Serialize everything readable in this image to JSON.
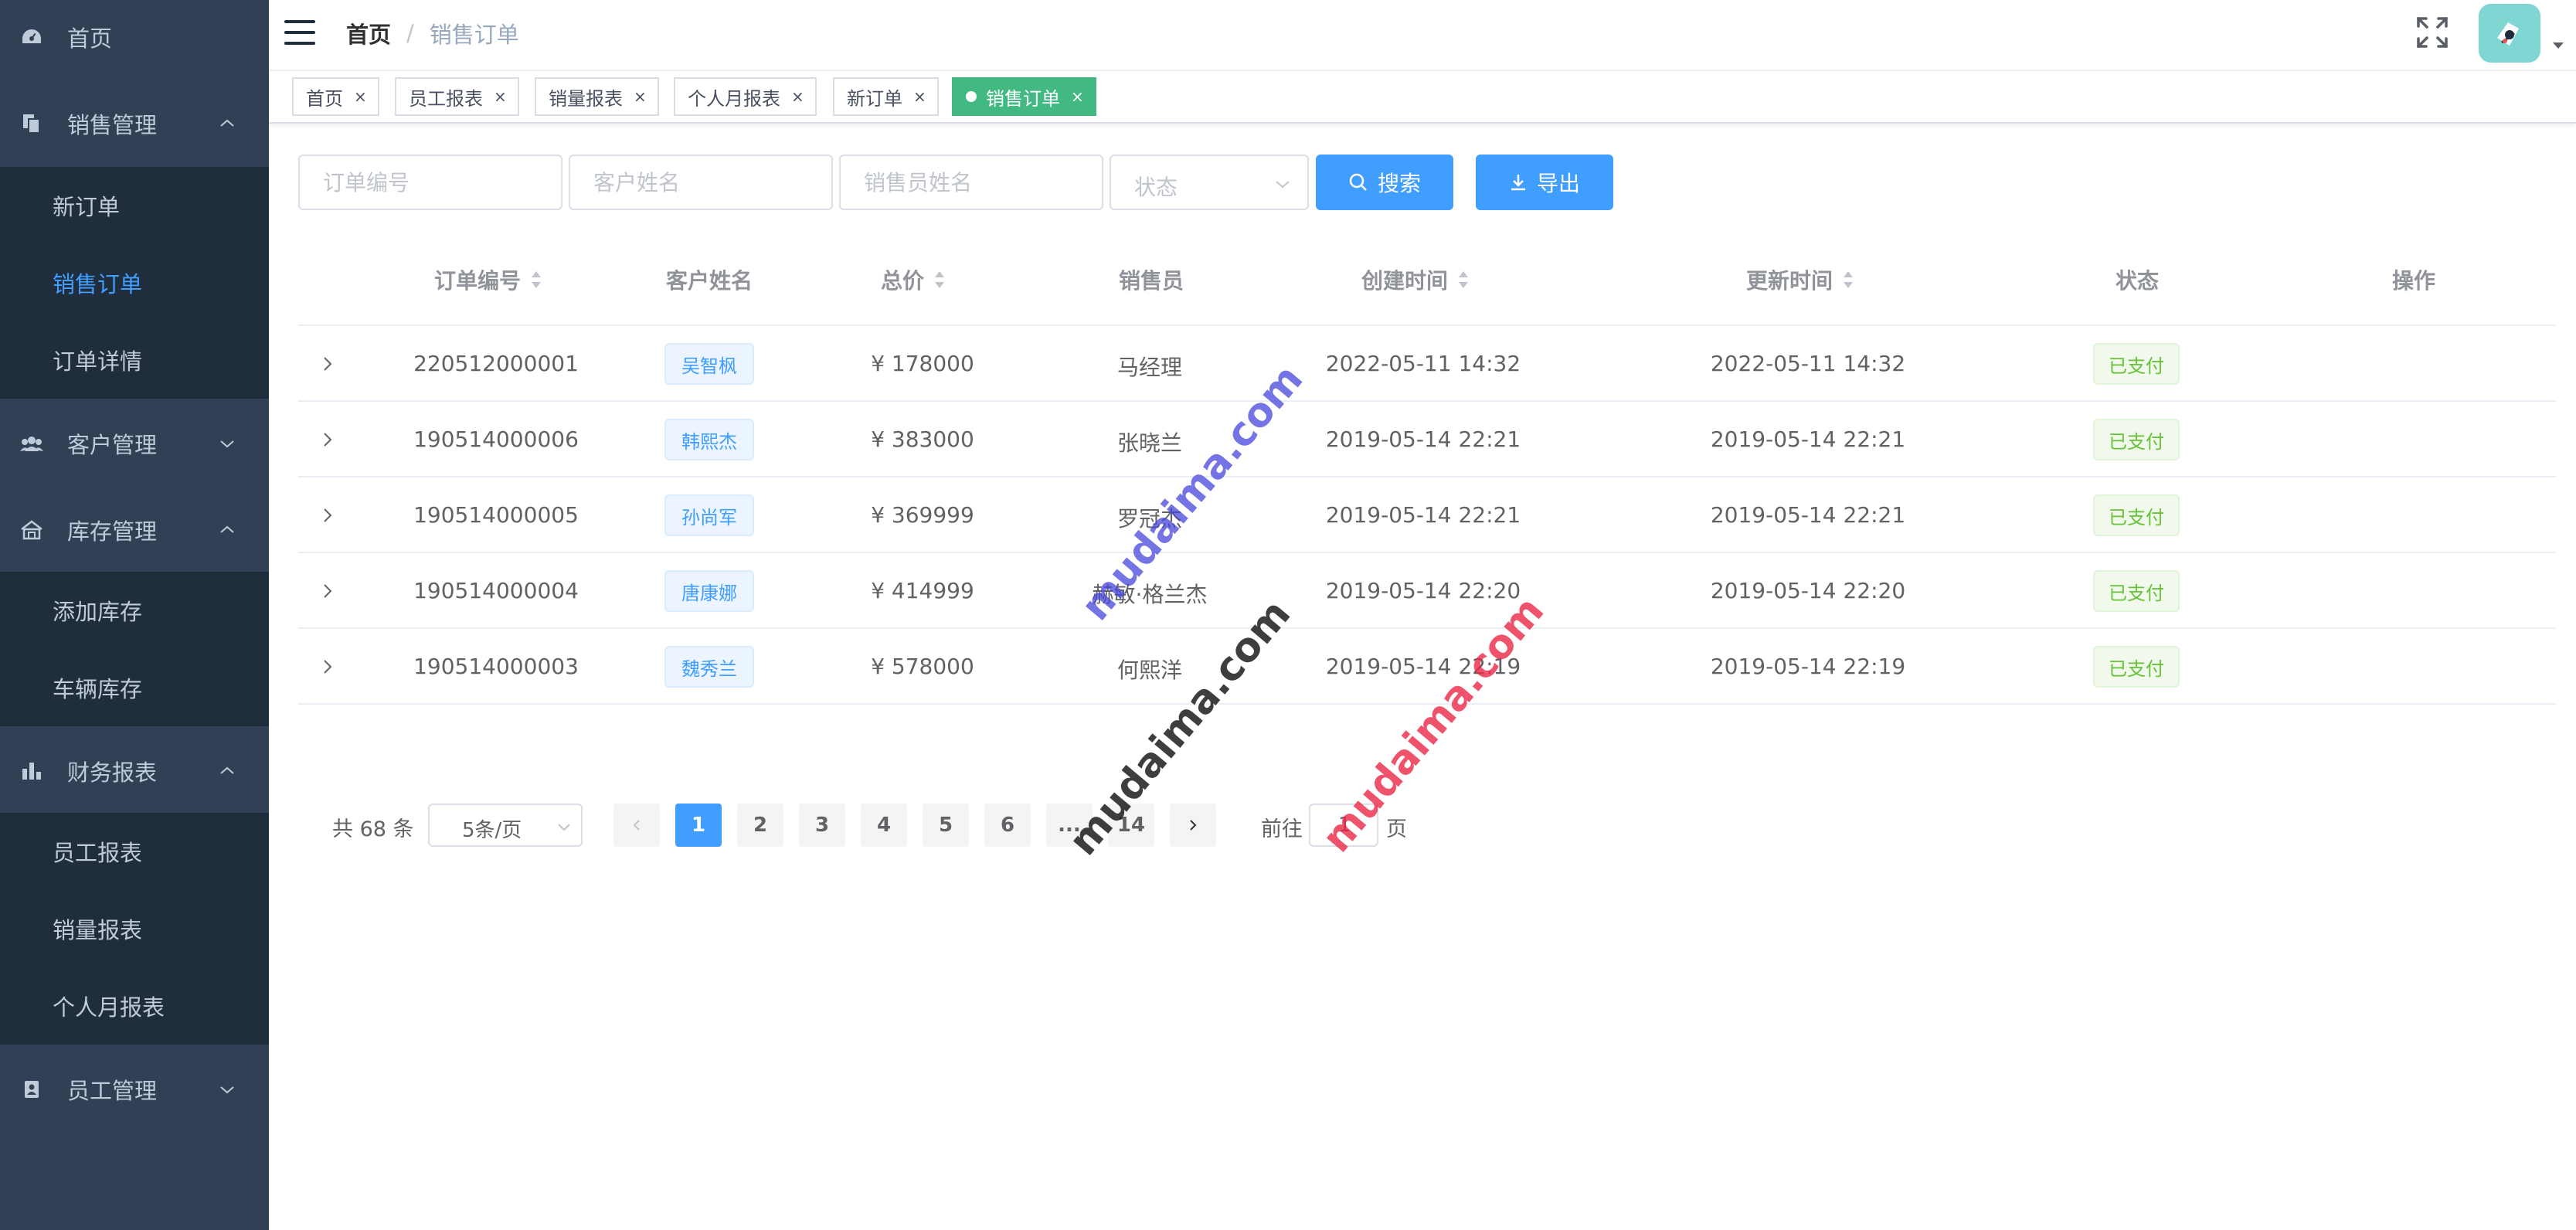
{
  "sidebar": {
    "items": [
      {
        "label": "首页",
        "icon": "dashboard-icon"
      },
      {
        "label": "销售管理",
        "icon": "sales-icon",
        "expanded": true,
        "children": [
          {
            "label": "新订单"
          },
          {
            "label": "销售订单",
            "active": true
          },
          {
            "label": "订单详情"
          }
        ]
      },
      {
        "label": "客户管理",
        "icon": "users-icon",
        "expanded": false
      },
      {
        "label": "库存管理",
        "icon": "warehouse-icon",
        "expanded": true,
        "children": [
          {
            "label": "添加库存"
          },
          {
            "label": "车辆库存"
          }
        ]
      },
      {
        "label": "财务报表",
        "icon": "bar-chart-icon",
        "expanded": true,
        "children": [
          {
            "label": "员工报表"
          },
          {
            "label": "销量报表"
          },
          {
            "label": "个人月报表"
          }
        ]
      },
      {
        "label": "员工管理",
        "icon": "badge-icon",
        "expanded": false
      }
    ]
  },
  "navbar": {
    "breadcrumb": {
      "home": "首页",
      "separator": "/",
      "current": "销售订单"
    }
  },
  "tags": [
    {
      "label": "首页",
      "close": "×"
    },
    {
      "label": "员工报表",
      "close": "×"
    },
    {
      "label": "销量报表",
      "close": "×"
    },
    {
      "label": "个人月报表",
      "close": "×"
    },
    {
      "label": "新订单",
      "close": "×"
    },
    {
      "label": "销售订单",
      "close": "×",
      "active": true
    }
  ],
  "filters": {
    "order_no_placeholder": "订单编号",
    "customer_placeholder": "客户姓名",
    "salesperson_placeholder": "销售员姓名",
    "status_placeholder": "状态",
    "search_label": "搜索",
    "export_label": "导出"
  },
  "table": {
    "columns": {
      "order_no": "订单编号",
      "customer": "客户姓名",
      "total": "总价",
      "salesperson": "销售员",
      "created": "创建时间",
      "updated": "更新时间",
      "status": "状态",
      "actions": "操作"
    },
    "rows": [
      {
        "order_no": "220512000001",
        "customer": "吴智枫",
        "total": "¥ 178000",
        "salesperson": "马经理",
        "created": "2022-05-11 14:32",
        "updated": "2022-05-11 14:32",
        "status": "已支付"
      },
      {
        "order_no": "190514000006",
        "customer": "韩熙杰",
        "total": "¥ 383000",
        "salesperson": "张晓兰",
        "created": "2019-05-14 22:21",
        "updated": "2019-05-14 22:21",
        "status": "已支付"
      },
      {
        "order_no": "190514000005",
        "customer": "孙尚军",
        "total": "¥ 369999",
        "salesperson": "罗冠杰",
        "created": "2019-05-14 22:21",
        "updated": "2019-05-14 22:21",
        "status": "已支付"
      },
      {
        "order_no": "190514000004",
        "customer": "唐康娜",
        "total": "¥ 414999",
        "salesperson": "赫敏·格兰杰",
        "created": "2019-05-14 22:20",
        "updated": "2019-05-14 22:20",
        "status": "已支付"
      },
      {
        "order_no": "190514000003",
        "customer": "魏秀兰",
        "total": "¥ 578000",
        "salesperson": "何熙洋",
        "created": "2019-05-14 22:19",
        "updated": "2019-05-14 22:19",
        "status": "已支付"
      }
    ]
  },
  "pagination": {
    "total": "共 68 条",
    "page_size": "5条/页",
    "pages": [
      "1",
      "2",
      "3",
      "4",
      "5",
      "6",
      "...",
      "14"
    ],
    "current": "1",
    "goto_label": "前往",
    "goto_value": "1",
    "page_suffix": "页"
  },
  "watermarks": [
    "mudaima.com",
    "mudaima.com",
    "mudaima.com"
  ],
  "colors": {
    "sidebar_bg": "#304156",
    "submenu_bg": "#1f2d3d",
    "accent": "#409eff",
    "active_tag": "#42b983",
    "success": "#67c23a"
  }
}
